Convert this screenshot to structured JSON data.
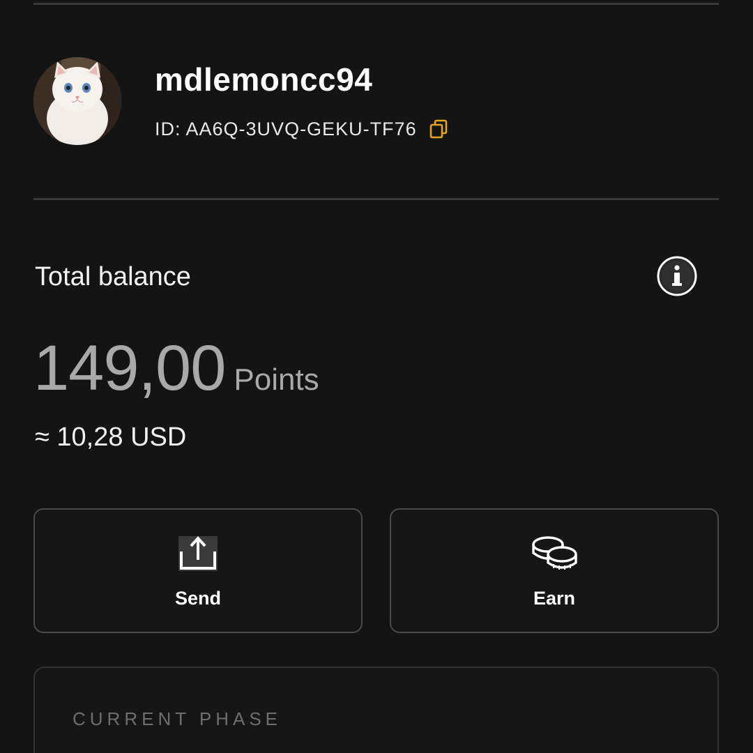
{
  "profile": {
    "username": "mdlemoncc94",
    "id_text": "ID: AA6Q-3UVQ-GEKU-TF76",
    "avatar_icon": "avatar-image",
    "copy_icon": "copy-icon"
  },
  "balance": {
    "label": "Total balance",
    "amount": "149,00",
    "unit": "Points",
    "usd": "≈ 10,28 USD",
    "info_icon": "info-icon"
  },
  "actions": [
    {
      "label": "Send",
      "icon": "upload-icon"
    },
    {
      "label": "Earn",
      "icon": "coins-icon"
    }
  ],
  "phase": {
    "label": "CURRENT PHASE"
  },
  "colors": {
    "background": "#141414",
    "accent": "#e3a51e",
    "muted_amount": "#a9a9a9",
    "border": "#4a4a4a"
  }
}
